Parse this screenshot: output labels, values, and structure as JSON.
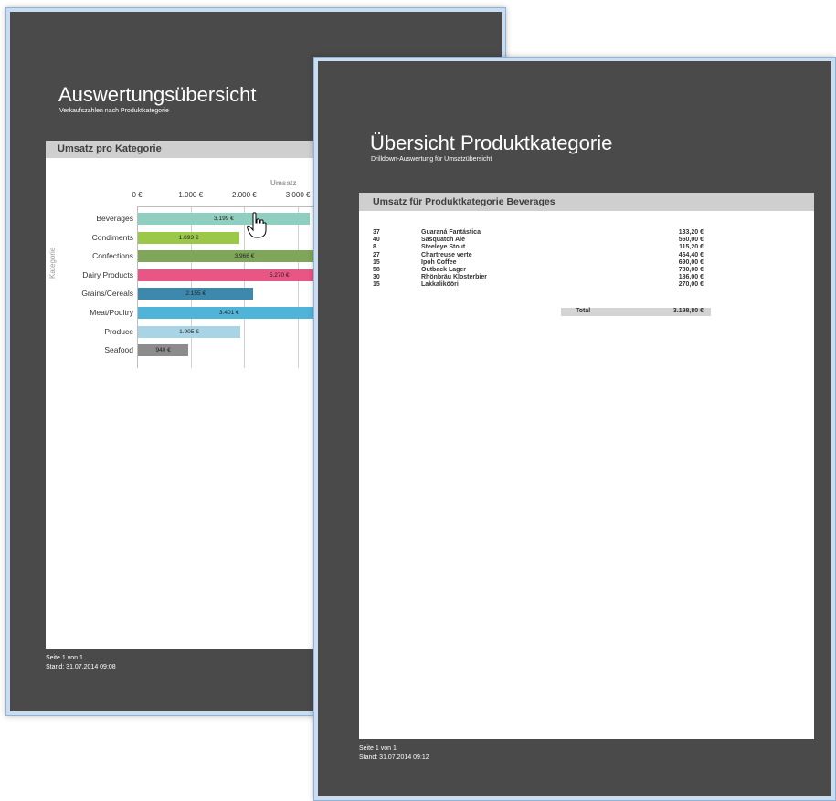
{
  "window1": {
    "title": "Auswertungsübersicht",
    "subtitle": "Verkaufszahlen nach Produktkategorie",
    "section_header": "Umsatz pro Kategorie",
    "footer_page": "Seite 1 von 1",
    "footer_date": "Stand: 31.07.2014 09:08"
  },
  "window2": {
    "title": "Übersicht Produktkategorie",
    "subtitle": "Drilldown-Auswertung für Umsatzübersicht",
    "section_header": "Umsatz für Produktkategorie Beverages",
    "rows": [
      {
        "qty": "37",
        "product": "Guaraná Fantástica",
        "amount": "133,20 €"
      },
      {
        "qty": "40",
        "product": "Sasquatch Ale",
        "amount": "560,00 €"
      },
      {
        "qty": "8",
        "product": "Steeleye Stout",
        "amount": "115,20 €"
      },
      {
        "qty": "27",
        "product": "Chartreuse verte",
        "amount": "464,40 €"
      },
      {
        "qty": "15",
        "product": "Ipoh Coffee",
        "amount": "690,00 €"
      },
      {
        "qty": "58",
        "product": "Outback Lager",
        "amount": "780,00 €"
      },
      {
        "qty": "30",
        "product": "Rhönbräu Klosterbier",
        "amount": "186,00 €"
      },
      {
        "qty": "15",
        "product": "Lakkalikööri",
        "amount": "270,00 €"
      }
    ],
    "total_label": "Total",
    "total_value": "3.198,80 €",
    "footer_page": "Seite 1 von 1",
    "footer_date": "Stand: 31.07.2014 09:12"
  },
  "chart_data": {
    "type": "bar",
    "orientation": "horizontal",
    "title": "",
    "xlabel": "Umsatz",
    "ylabel": "Kategorie",
    "categories": [
      "Beverages",
      "Condiments",
      "Confections",
      "Dairy Products",
      "Grains/Cereals",
      "Meat/Poultry",
      "Produce",
      "Seafood"
    ],
    "values": [
      3199,
      1893,
      3966,
      5270,
      2155,
      3401,
      1905,
      940
    ],
    "value_labels": [
      "3.199 €",
      "1.893 €",
      "3.966 €",
      "5.270 €",
      "2.155 €",
      "3.401 €",
      "1.905 €",
      "940 €"
    ],
    "colors": [
      "#8fcfc0",
      "#9cc84a",
      "#7fa65a",
      "#e95585",
      "#3d88ad",
      "#50b4d8",
      "#a8d4e6",
      "#8c8c8c"
    ],
    "ticks": [
      0,
      1000,
      2000,
      3000
    ],
    "tick_labels": [
      "0 €",
      "1.000 €",
      "2.000 €",
      "3.000 €"
    ],
    "xlim": [
      0,
      3500
    ]
  }
}
